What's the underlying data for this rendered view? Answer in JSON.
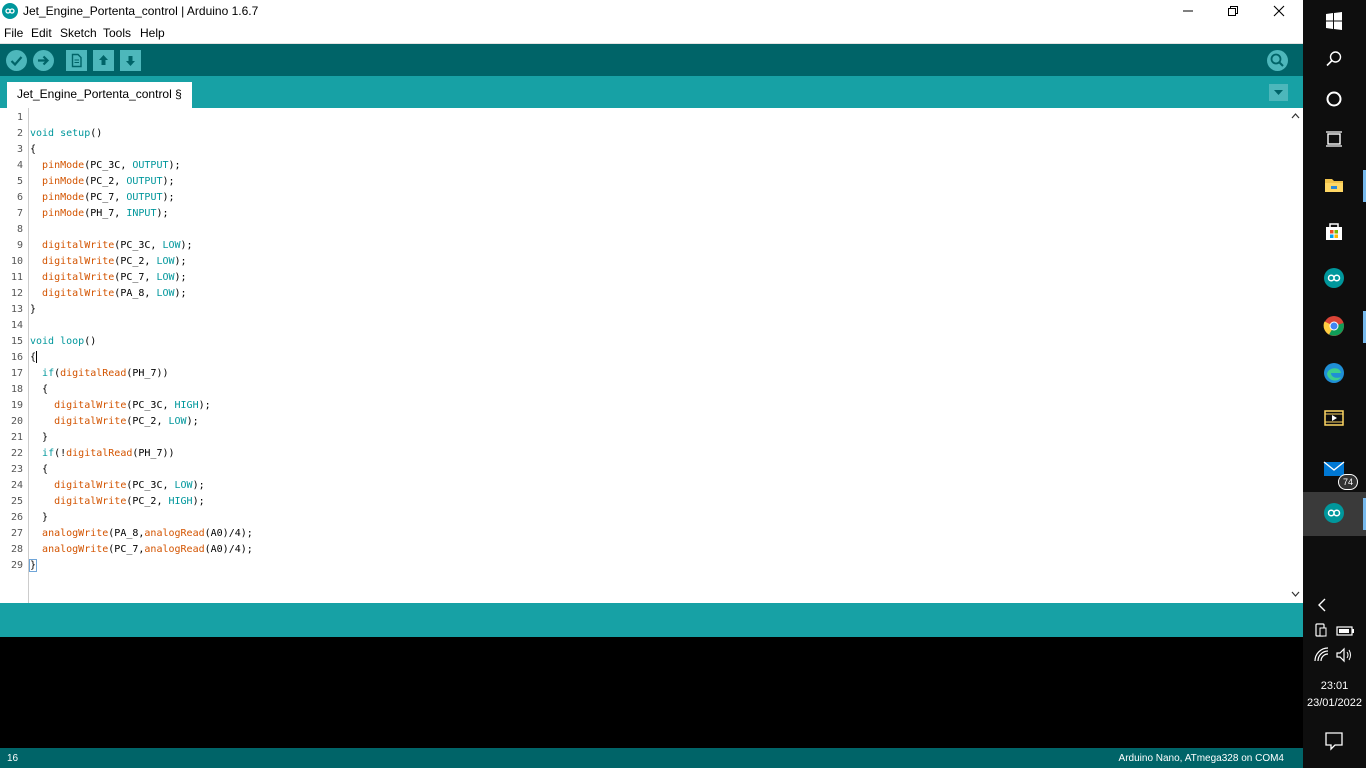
{
  "window": {
    "title": "Jet_Engine_Portenta_control | Arduino 1.6.7"
  },
  "menu": [
    "File",
    "Edit",
    "Sketch",
    "Tools",
    "Help"
  ],
  "toolbar": {
    "buttons": [
      "verify-icon",
      "upload-icon",
      "new-icon",
      "open-icon",
      "save-icon",
      "serial-monitor-icon"
    ]
  },
  "tab": {
    "label": "Jet_Engine_Portenta_control §"
  },
  "editor": {
    "lines": [
      "",
      "void setup()",
      "{",
      "  pinMode(PC_3C, OUTPUT);",
      "  pinMode(PC_2, OUTPUT);",
      "  pinMode(PC_7, OUTPUT);",
      "  pinMode(PH_7, INPUT);",
      "",
      "  digitalWrite(PC_3C, LOW);",
      "  digitalWrite(PC_2, LOW);",
      "  digitalWrite(PC_7, LOW);",
      "  digitalWrite(PA_8, LOW);",
      "}",
      "",
      "void loop()",
      "{",
      "  if(digitalRead(PH_7))",
      "  {",
      "    digitalWrite(PC_3C, HIGH);",
      "    digitalWrite(PC_2, LOW);",
      "  }",
      "  if(!digitalRead(PH_7))",
      "  {",
      "    digitalWrite(PC_3C, LOW);",
      "    digitalWrite(PC_2, HIGH);",
      "  }",
      "  analogWrite(PA_8,analogRead(A0)/4);",
      "  analogWrite(PC_7,analogRead(A0)/4);",
      "}"
    ],
    "caret_line": 16
  },
  "footer": {
    "line_number": "16",
    "board": "Arduino Nano, ATmega328 on COM4"
  },
  "taskbar": {
    "mail_badge": "74",
    "time": "23:01",
    "date": "23/01/2022"
  },
  "colors": {
    "toolbar": "#006468",
    "tabbar": "#17a1a5",
    "keyword": "#00979c",
    "function": "#d35400"
  }
}
